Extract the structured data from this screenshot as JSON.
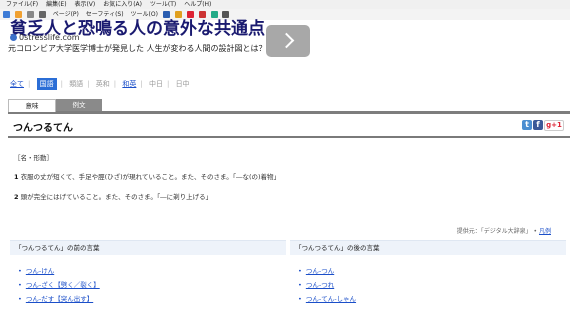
{
  "browser": {
    "menu": [
      "ファイル(F)",
      "編集(E)",
      "表示(V)",
      "お気に入り(A)",
      "ツール(T)",
      "ヘルプ(H)"
    ],
    "toolbar": [
      "ページ(P)",
      "セーフティ(S)",
      "ツール(O)"
    ]
  },
  "ad": {
    "headline": "貧乏人と恐鳴る人の意外な共通点",
    "url": "0stresslife.com",
    "description": "元コロンビア大学医学博士が発見した 人生が変わる人間の設計図とは？"
  },
  "filters": {
    "all": "全て",
    "kokugo": "国語",
    "ruigo": "類語",
    "eiwa": "英和",
    "waei": "和英",
    "chunichi": "中日",
    "nicchu": "日中"
  },
  "tabs": {
    "meaning": "意味",
    "examples": "例文"
  },
  "entry": {
    "word": "つんつるてん",
    "pos": "［名・形動］",
    "def1_num": "1",
    "def1": "衣服の丈が短くて、手足や脛(ひざ)が現れていること。また、そのさま。「―な(の)着物」",
    "def2_num": "2",
    "def2": "頭が完全にはげていること。また、そのさま。「―に剃り上げる」"
  },
  "source": {
    "text": "提供元：「デジタル大辞泉」 •",
    "link": "凡例"
  },
  "before": {
    "title": "「つんつるてん」の前の言葉",
    "items": [
      "つん-けん",
      "つん-ざく【劈く／裂く】",
      "つん-だす【突ん出す】"
    ]
  },
  "after": {
    "title": "「つんつるてん」の後の言葉",
    "items": [
      "つん-つん",
      "つん-つれ",
      "つん-てん-しゃん"
    ]
  }
}
